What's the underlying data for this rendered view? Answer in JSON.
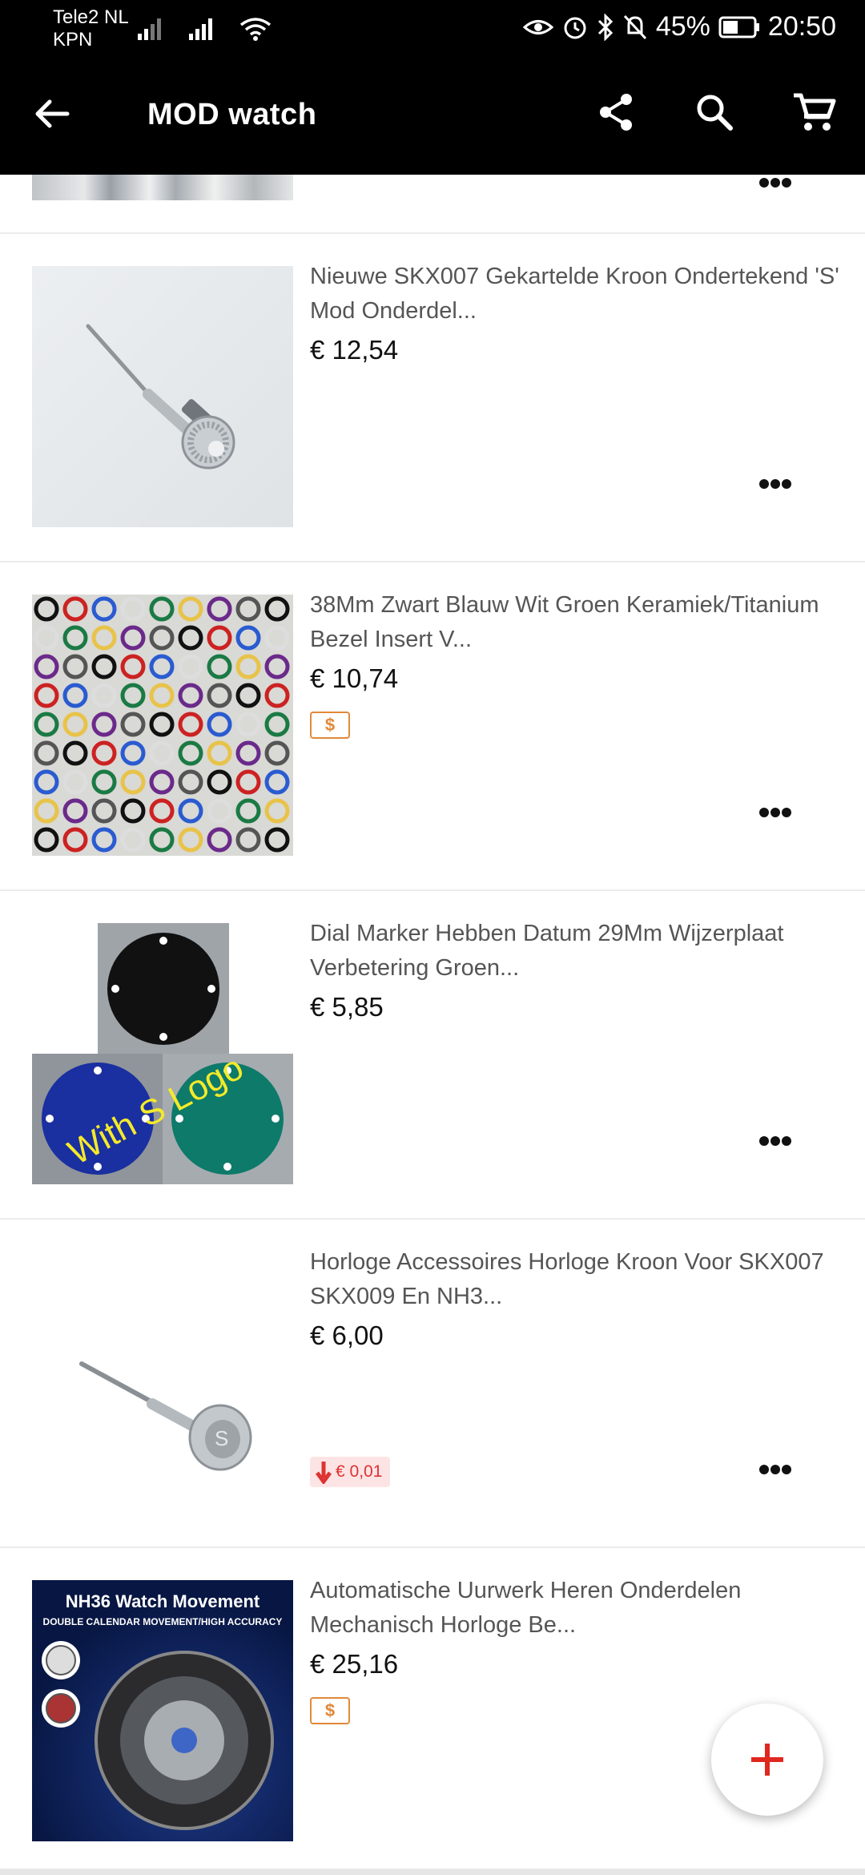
{
  "status": {
    "carrier_line1": "Tele2 NL",
    "carrier_line2": "KPN",
    "battery": "45%",
    "time": "20:50"
  },
  "appbar": {
    "title": "MOD watch"
  },
  "products": [
    {
      "title": "Nieuwe SKX007 Gekartelde Kroon Ondertekend 'S' Mod Onderdel...",
      "price": "€ 12,54"
    },
    {
      "title": "38Mm Zwart Blauw Wit Groen Keramiek/Titanium Bezel Insert V...",
      "price": "€ 10,74",
      "badge": "$"
    },
    {
      "title": "Dial Marker Hebben Datum 29Mm Wijzerplaat Verbetering Groen...",
      "price": "€ 5,85",
      "image_text": "With S Logo"
    },
    {
      "title": "Horloge Accessoires Horloge Kroon Voor SKX007 SKX009 En NH3...",
      "price": "€ 6,00",
      "price_drop": "€ 0,01"
    },
    {
      "title": "Automatische Uurwerk Heren Onderdelen Mechanisch Horloge Be...",
      "price": "€ 25,16",
      "badge": "$",
      "image_title": "NH36 Watch Movement",
      "image_subtitle": "DOUBLE CALENDAR MOVEMENT/HIGH ACCURACY"
    }
  ],
  "colors": {
    "accent_red": "#e0281f",
    "badge_orange": "#e2893a"
  }
}
